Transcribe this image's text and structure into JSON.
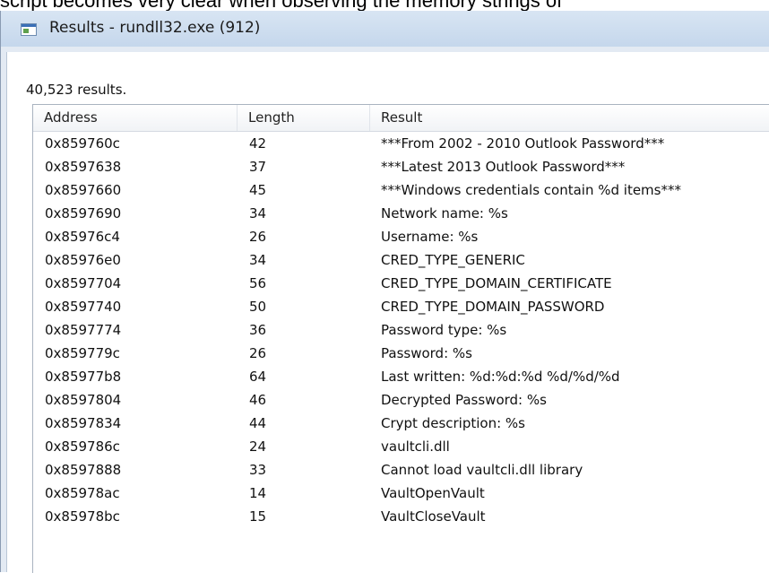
{
  "background_text": "script becomes very clear when observing the memory strings of",
  "window": {
    "title": "Results - rundll32.exe (912)",
    "icon": "app-window-icon"
  },
  "results_count": "40,523 results.",
  "columns": [
    "Address",
    "Length",
    "Result"
  ],
  "rows": [
    {
      "address": "0x859760c",
      "length": "42",
      "result": "***From 2002 - 2010 Outlook Password***"
    },
    {
      "address": "0x8597638",
      "length": "37",
      "result": "***Latest 2013 Outlook Password***"
    },
    {
      "address": "0x8597660",
      "length": "45",
      "result": "***Windows credentials contain %d items***"
    },
    {
      "address": "0x8597690",
      "length": "34",
      "result": "Network name: %s"
    },
    {
      "address": "0x85976c4",
      "length": "26",
      "result": "Username: %s"
    },
    {
      "address": "0x85976e0",
      "length": "34",
      "result": "CRED_TYPE_GENERIC"
    },
    {
      "address": "0x8597704",
      "length": "56",
      "result": "CRED_TYPE_DOMAIN_CERTIFICATE"
    },
    {
      "address": "0x8597740",
      "length": "50",
      "result": "CRED_TYPE_DOMAIN_PASSWORD"
    },
    {
      "address": "0x8597774",
      "length": "36",
      "result": "Password type: %s"
    },
    {
      "address": "0x859779c",
      "length": "26",
      "result": "Password: %s"
    },
    {
      "address": "0x85977b8",
      "length": "64",
      "result": "Last written: %d:%d:%d %d/%d/%d"
    },
    {
      "address": "0x8597804",
      "length": "46",
      "result": "Decrypted Password: %s"
    },
    {
      "address": "0x8597834",
      "length": "44",
      "result": "Crypt description: %s"
    },
    {
      "address": "0x859786c",
      "length": "24",
      "result": "vaultcli.dll"
    },
    {
      "address": "0x8597888",
      "length": "33",
      "result": "Cannot load vaultcli.dll library"
    },
    {
      "address": "0x85978ac",
      "length": "14",
      "result": "VaultOpenVault"
    },
    {
      "address": "0x85978bc",
      "length": "15",
      "result": "VaultCloseVault"
    }
  ]
}
